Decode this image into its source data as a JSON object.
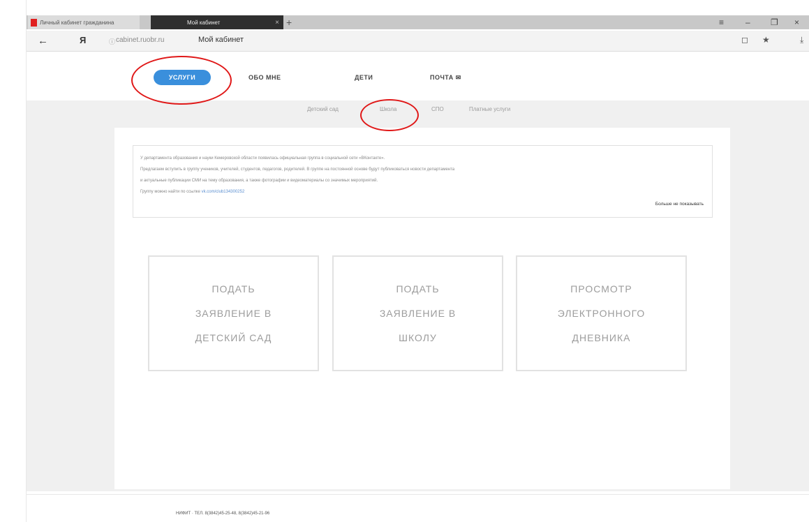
{
  "browser": {
    "tabs": [
      {
        "label": "Личный кабинет гражданина"
      },
      {
        "label": "Мой кабинет"
      }
    ],
    "new_tab": "+",
    "controls": {
      "menu": "≡",
      "minimize": "–",
      "restore": "❐",
      "close": "×"
    },
    "address": {
      "back": "←",
      "ya": "Я",
      "url": "cabinet.ruobr.ru",
      "title": "Мой кабинет",
      "bookmark": "★",
      "download": "⤓",
      "ext": "◻"
    }
  },
  "nav": {
    "active": "УСЛУГИ",
    "items": [
      "ОБО МНЕ",
      "ДЕТИ",
      "ПОЧТА ✉"
    ]
  },
  "subnav": [
    "Детский сад",
    "Школа",
    "СПО",
    "Платные услуги"
  ],
  "notice": {
    "lines": [
      "У департамента образования и науки Кемеровской области появилась официальная группа в социальной сети «ВКонтакте».",
      "Предлагаем вступить в группу учеников, учителей, студентов, педагогов, родителей. В группе на постоянной основе будут публиковаться новости департамента",
      "и актуальные публикации СМИ на тему образования, а также фотографии и видеоматериалы со значимых мероприятий."
    ],
    "link_prefix": "Группу можно найти по ссылке ",
    "link": "vk.com/club134300252",
    "dismiss": "Больше не показывать"
  },
  "cards": [
    {
      "label": "ПОДАТЬ ЗАЯВЛЕНИЕ В ДЕТСКИЙ САД",
      "lines": [
        "ПОДАТЬ",
        "ЗАЯВЛЕНИЕ В",
        "ДЕТСКИЙ САД"
      ]
    },
    {
      "label": "ПОДАТЬ ЗАЯВЛЕНИЕ В ШКОЛУ",
      "lines": [
        "ПОДАТЬ",
        "ЗАЯВЛЕНИЕ В",
        "ШКОЛУ"
      ]
    },
    {
      "label": "ПРОСМОТР ЭЛЕКТРОННОГО ДНЕВНИКА",
      "lines": [
        "ПРОСМОТР",
        "ЭЛЕКТРОННОГО",
        "ДНЕВНИКА"
      ]
    }
  ],
  "footer": "НИФИТ · ТЕЛ. 8(3842)45-25-48, 8(3842)45-21-96",
  "colors": {
    "accent": "#3a8fdc",
    "highlight_ring": "#e01818"
  }
}
